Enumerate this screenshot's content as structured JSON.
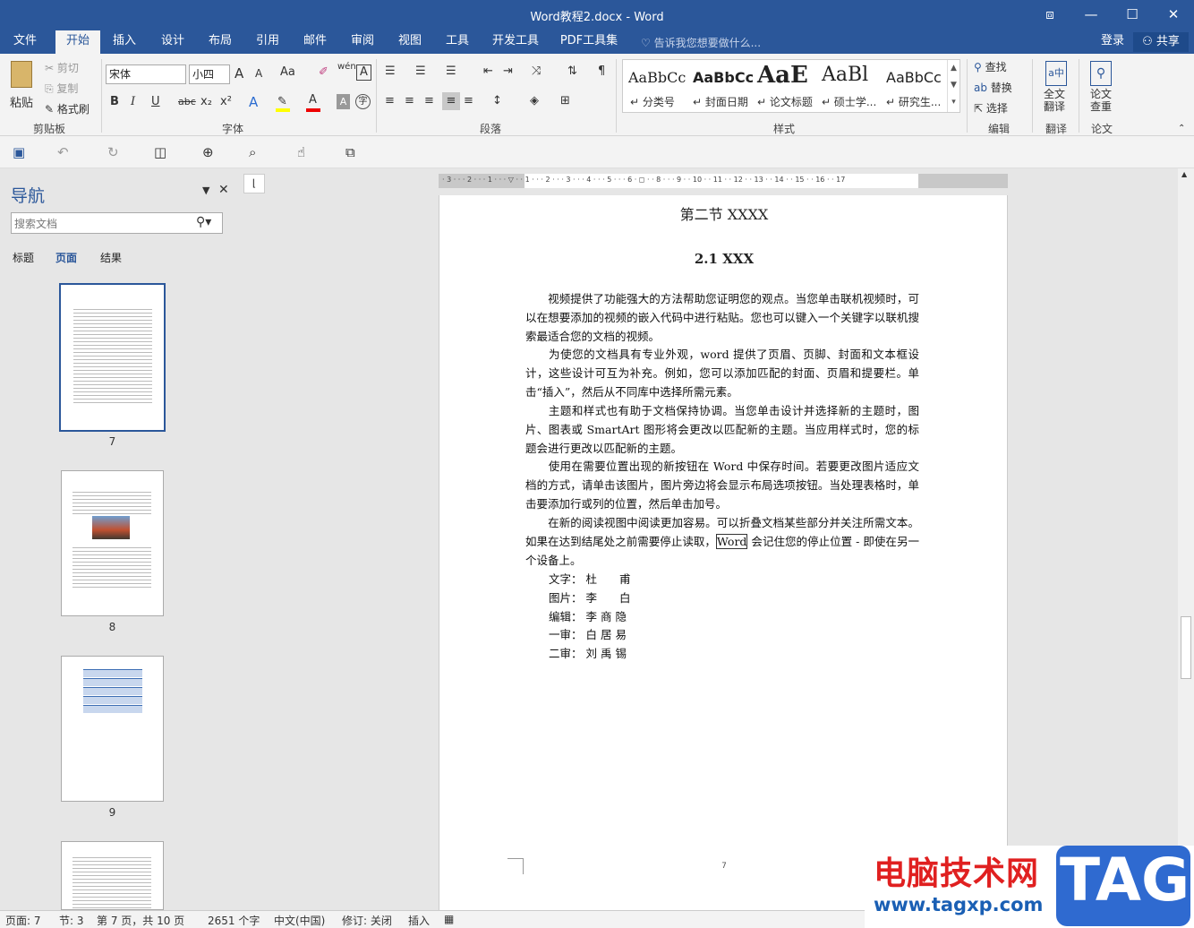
{
  "window": {
    "title": "Word教程2.docx - Word",
    "controls": {
      "ribbon_display": "⧈",
      "minimize": "—",
      "maximize": "☐",
      "close": "✕"
    }
  },
  "tabs": [
    "文件",
    "开始",
    "插入",
    "设计",
    "布局",
    "引用",
    "邮件",
    "审阅",
    "视图",
    "工具",
    "开发工具",
    "PDF工具集"
  ],
  "active_tab": "开始",
  "tell_me": "告诉我您想要做什么...",
  "account": {
    "login": "登录",
    "share": "共享"
  },
  "clipboard": {
    "paste": "粘贴",
    "cut": "剪切",
    "copy": "复制",
    "format_painter": "格式刷",
    "label": "剪贴板"
  },
  "font": {
    "name": "宋体",
    "size": "小四",
    "label": "字体",
    "bold": "B",
    "italic": "I",
    "underline": "U",
    "strike": "abc",
    "sub": "x₂",
    "sup": "x²",
    "grow": "A",
    "shrink": "A",
    "case": "Aa",
    "wen": "wén",
    "boxA": "A",
    "fontcolor": "A",
    "shadeA": "A",
    "circ": "字"
  },
  "paragraph": {
    "label": "段落"
  },
  "styles": {
    "label": "样式",
    "items": [
      {
        "preview": "AaBbCc",
        "name": "↵ 分类号"
      },
      {
        "preview": "AaBbCc",
        "name": "↵ 封面日期"
      },
      {
        "preview": "AaE",
        "name": "↵ 论文标题"
      },
      {
        "preview": "AaBl",
        "name": "↵ 硕士学..."
      },
      {
        "preview": "AaBbCc",
        "name": "↵ 研究生..."
      }
    ]
  },
  "editing": {
    "find": "查找",
    "replace": "替换",
    "select": "选择",
    "label": "编辑"
  },
  "translate": {
    "full": "全文\n翻译",
    "label": "翻译"
  },
  "paper": {
    "check": "论文\n查重",
    "label": "论文"
  },
  "nav_pane": {
    "title": "导航",
    "search_placeholder": "搜索文档",
    "tabs": [
      "标题",
      "页面",
      "结果"
    ],
    "active_tab": "页面",
    "pages": [
      "7",
      "8",
      "9"
    ]
  },
  "document": {
    "ruler": "· 3 · · · 2 · · · 1 · · · ▽ · · 1 · · · 2 · · · 3 · · · 4 · · · 5 · · · 6 · ◻ · · 8 · · · 9 · · 10 · · 11 · · 12 · · 13 · · 14 · · 15 · · 16 · · 17",
    "section_title": "第二节  XXXX",
    "heading": "2.1 XXX",
    "paragraphs": [
      "　　视频提供了功能强大的方法帮助您证明您的观点。当您单击联机视频时，可以在想要添加的视频的嵌入代码中进行粘贴。您也可以键入一个关键字以联机搜索最适合您的文档的视频。",
      "　　为使您的文档具有专业外观，word 提供了页眉、页脚、封面和文本框设计，这些设计可互为补充。例如，您可以添加匹配的封面、页眉和提要栏。单击“插入”，然后从不同库中选择所需元素。",
      "　　主题和样式也有助于文档保持协调。当您单击设计并选择新的主题时，图片、图表或 SmartArt 图形将会更改以匹配新的主题。当应用样式时，您的标题会进行更改以匹配新的主题。",
      "　　使用在需要位置出现的新按钮在 Word 中保存时间。若要更改图片适应文档的方式，请单击该图片，图片旁边将会显示布局选项按钮。当处理表格时，单击要添加行或列的位置，然后单击加号。"
    ],
    "para5_a": "　　在新的阅读视图中阅读更加容易。可以折叠文档某些部分并关注所需文本。如果在达到结尾处之前需要停止读取，",
    "para5_word": "Word",
    "para5_b": " 会记住您的停止位置 - 即使在另一个设备上。",
    "credits": [
      {
        "role": "文字：",
        "name": "杜　　甫"
      },
      {
        "role": "图片：",
        "name": "李　　白"
      },
      {
        "role": "编辑：",
        "name": "李 商 隐"
      },
      {
        "role": "一审：",
        "name": "白 居 易"
      },
      {
        "role": "二审：",
        "name": "刘 禹 锡"
      }
    ],
    "page_number": "7"
  },
  "statusbar": {
    "page": "页面: 7",
    "section": "节: 3",
    "page_of": "第 7 页，共 10 页",
    "words": "2651 个字",
    "language": "中文(中国)",
    "revisions": "修订: 关闭",
    "insert": "插入"
  },
  "watermark": {
    "cn": "电脑技术网",
    "url": "www.tagxp.com",
    "tag": "TAG"
  }
}
